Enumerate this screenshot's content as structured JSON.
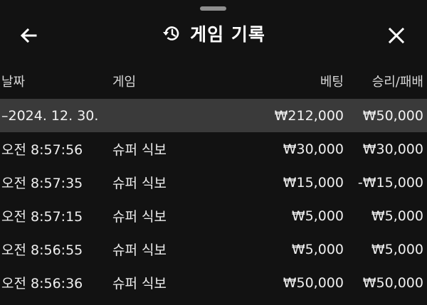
{
  "header": {
    "title": "게임 기록",
    "back_icon": "arrow-left-icon",
    "history_icon": "history-icon",
    "close_icon": "close-icon"
  },
  "columns": {
    "date": "날짜",
    "game": "게임",
    "bet": "베팅",
    "result": "승리/패배"
  },
  "group": {
    "date": "–2024. 12. 30.",
    "bet_total": "₩212,000",
    "result_total": "₩50,000"
  },
  "rows": [
    {
      "time": "오전 8:57:56",
      "game": "슈퍼 식보",
      "bet": "₩30,000",
      "result": "₩30,000"
    },
    {
      "time": "오전 8:57:35",
      "game": "슈퍼 식보",
      "bet": "₩15,000",
      "result": "-₩15,000"
    },
    {
      "time": "오전 8:57:15",
      "game": "슈퍼 식보",
      "bet": "₩5,000",
      "result": "₩5,000"
    },
    {
      "time": "오전 8:56:55",
      "game": "슈퍼 식보",
      "bet": "₩5,000",
      "result": "₩5,000"
    },
    {
      "time": "오전 8:56:36",
      "game": "슈퍼 식보",
      "bet": "₩50,000",
      "result": "₩50,000"
    }
  ],
  "colors": {
    "background": "#121212",
    "group_row": "#3a3a3a",
    "text": "#f2f2f2"
  }
}
